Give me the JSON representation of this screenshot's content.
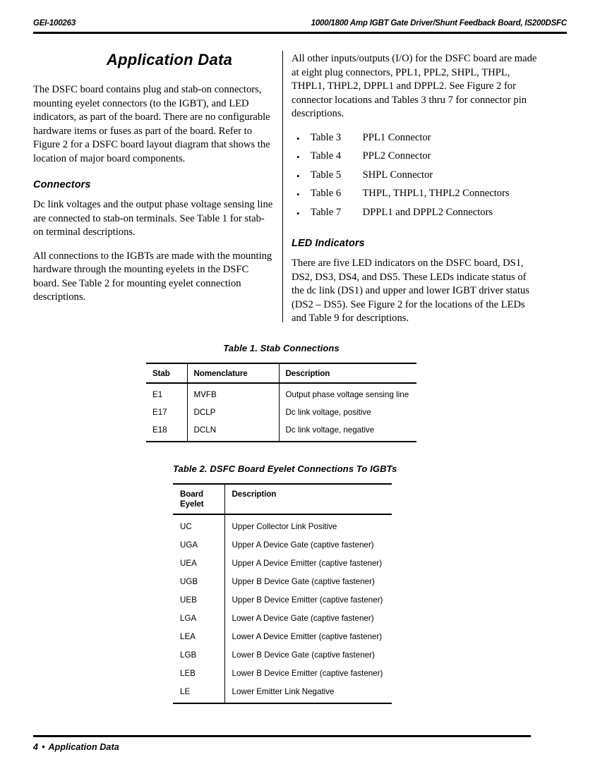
{
  "header": {
    "doc_number": "GEI-100263",
    "title": "1000/1800 Amp IGBT Gate Driver/Shunt Feedback Board, IS200DSFC"
  },
  "left_column": {
    "section_title": "Application Data",
    "intro_paragraph": "The DSFC board contains plug and stab-on connectors, mounting eyelet connectors (to the IGBT), and LED indicators, as part of the board. There are no configurable hardware items or fuses as part of the board. Refer to Figure 2 for a DSFC board layout diagram that shows the location of major board components.",
    "connectors_heading": "Connectors",
    "connectors_paragraph_1": "Dc link voltages and the output phase voltage sensing line are connected to stab-on terminals. See Table 1 for stab-on terminal descriptions.",
    "connectors_paragraph_2": "All connections to the IGBTs are made with the mounting hardware through the mounting eyelets in the DSFC board. See Table 2 for mounting eyelet connection descriptions."
  },
  "right_column": {
    "io_paragraph": "All other inputs/outputs (I/O) for the DSFC board are made at eight plug connectors, PPL1, PPL2, SHPL, THPL, THPL1, THPL2, DPPL1 and DPPL2. See Figure 2 for connector locations and Tables 3 thru 7 for connector pin descriptions.",
    "bullet_glyph": "•",
    "table_list": [
      {
        "ref": "Table 3",
        "desc": "PPL1 Connector"
      },
      {
        "ref": "Table 4",
        "desc": "PPL2 Connector"
      },
      {
        "ref": "Table 5",
        "desc": "SHPL Connector"
      },
      {
        "ref": "Table 6",
        "desc": "THPL, THPL1, THPL2 Connectors"
      },
      {
        "ref": "Table 7",
        "desc": "DPPL1 and DPPL2 Connectors"
      }
    ],
    "led_heading": "LED Indicators",
    "led_paragraph": "There are five LED indicators on the DSFC board, DS1, DS2, DS3, DS4, and DS5. These LEDs indicate status of the dc link (DS1) and upper and lower IGBT driver status (DS2 – DS5). See Figure 2 for the locations of the LEDs and Table 9 for descriptions."
  },
  "table_1": {
    "caption": "Table 1.  Stab Connections",
    "columns": [
      "Stab",
      "Nomenclature",
      "Description"
    ],
    "rows": [
      [
        "E1",
        "MVFB",
        "Output phase voltage sensing line"
      ],
      [
        "E17",
        "DCLP",
        "Dc link voltage, positive"
      ],
      [
        "E18",
        "DCLN",
        "Dc link voltage, negative"
      ]
    ]
  },
  "table_2": {
    "caption": "Table 2.  DSFC Board Eyelet Connections To IGBTs",
    "columns": [
      "Board\nEyelet",
      "Description"
    ],
    "column_1_line_1": "Board",
    "column_1_line_2": "Eyelet",
    "rows": [
      [
        "UC",
        "Upper Collector Link Positive"
      ],
      [
        "UGA",
        "Upper A Device Gate (captive fastener)"
      ],
      [
        "UEA",
        "Upper A Device Emitter (captive fastener)"
      ],
      [
        "UGB",
        "Upper B Device Gate (captive fastener)"
      ],
      [
        "UEB",
        "Upper B Device Emitter (captive fastener)"
      ],
      [
        "LGA",
        "Lower A Device Gate (captive fastener)"
      ],
      [
        "LEA",
        "Lower A Device Emitter (captive fastener)"
      ],
      [
        "LGB",
        "Lower B Device Gate (captive fastener)"
      ],
      [
        "LEB",
        "Lower B Device Emitter (captive fastener)"
      ],
      [
        "LE",
        "Lower Emitter Link Negative"
      ]
    ]
  },
  "footer": {
    "page_number": "4",
    "separator": "•",
    "section_name": "Application Data"
  }
}
